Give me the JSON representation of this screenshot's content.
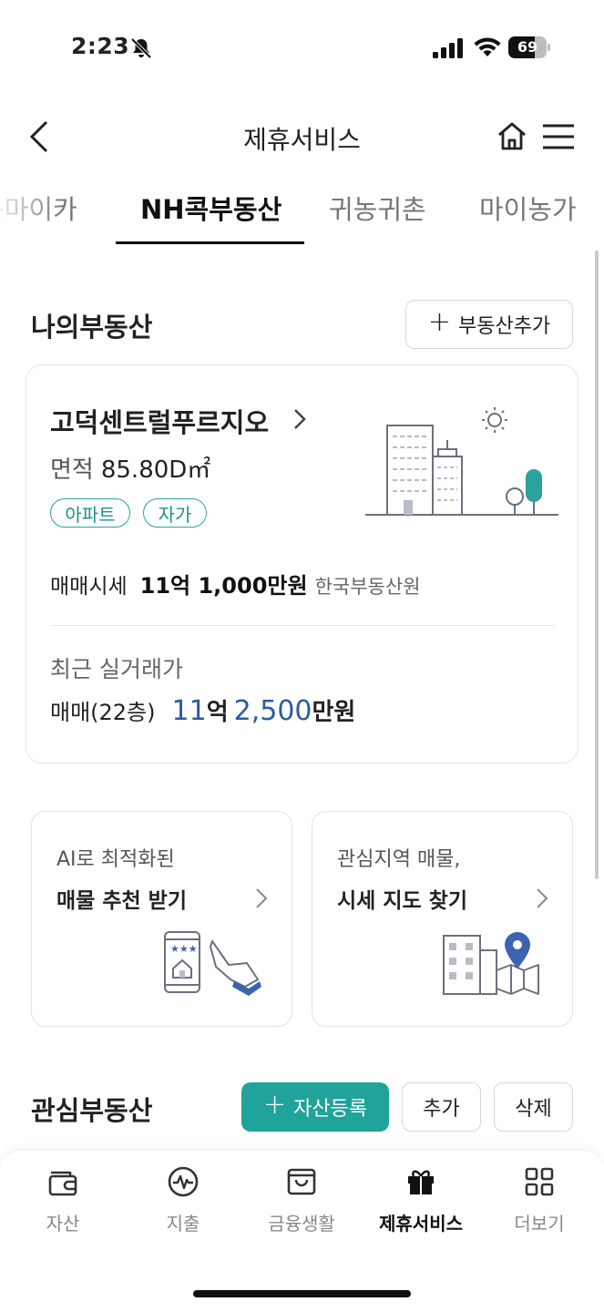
{
  "status": {
    "time": "2:23",
    "battery": "69",
    "battery_level": 0.69
  },
  "header": {
    "title": "제휴서비스"
  },
  "tabs": [
    {
      "label": "콕마이카"
    },
    {
      "label": "NH콕부동산",
      "active": true
    },
    {
      "label": "귀농귀촌"
    },
    {
      "label": "마이농가"
    }
  ],
  "my_estate": {
    "title": "나의부동산",
    "add_button": "부동산추가",
    "property": {
      "name": "고덕센트럴푸르지오",
      "area_label": "면적",
      "area_value": "85.80D㎡",
      "badges": [
        "아파트",
        "자가"
      ],
      "price_label": "매매시세",
      "price_value": "11억 1,000만원",
      "price_source": "한국부동산원",
      "recent_label": "최근 실거래가",
      "recent_type": "매매(22층)",
      "recent_num1": "11",
      "recent_unit1": "억",
      "recent_num2": "2,500",
      "recent_unit2": "만원"
    }
  },
  "features": [
    {
      "line1": "AI로 최적화된",
      "line2": "매물 추천 받기",
      "icon": "phone-house-hand-icon"
    },
    {
      "line1": "관심지역 매물,",
      "line2": "시세 지도 찾기",
      "icon": "building-map-pin-icon"
    }
  ],
  "favorites": {
    "title": "관심부동산",
    "register_button": "자산등록",
    "add_button": "추가",
    "delete_button": "삭제"
  },
  "bottom_nav": [
    {
      "label": "자산",
      "icon": "wallet-icon"
    },
    {
      "label": "지출",
      "icon": "pulse-icon"
    },
    {
      "label": "금융생활",
      "icon": "bag-icon"
    },
    {
      "label": "제휴서비스",
      "icon": "gift-icon",
      "active": true
    },
    {
      "label": "더보기",
      "icon": "grid-icon"
    }
  ],
  "colors": {
    "accent": "#1fa39a",
    "badge": "#2aa39b",
    "price_blue": "#2e5aa3"
  }
}
